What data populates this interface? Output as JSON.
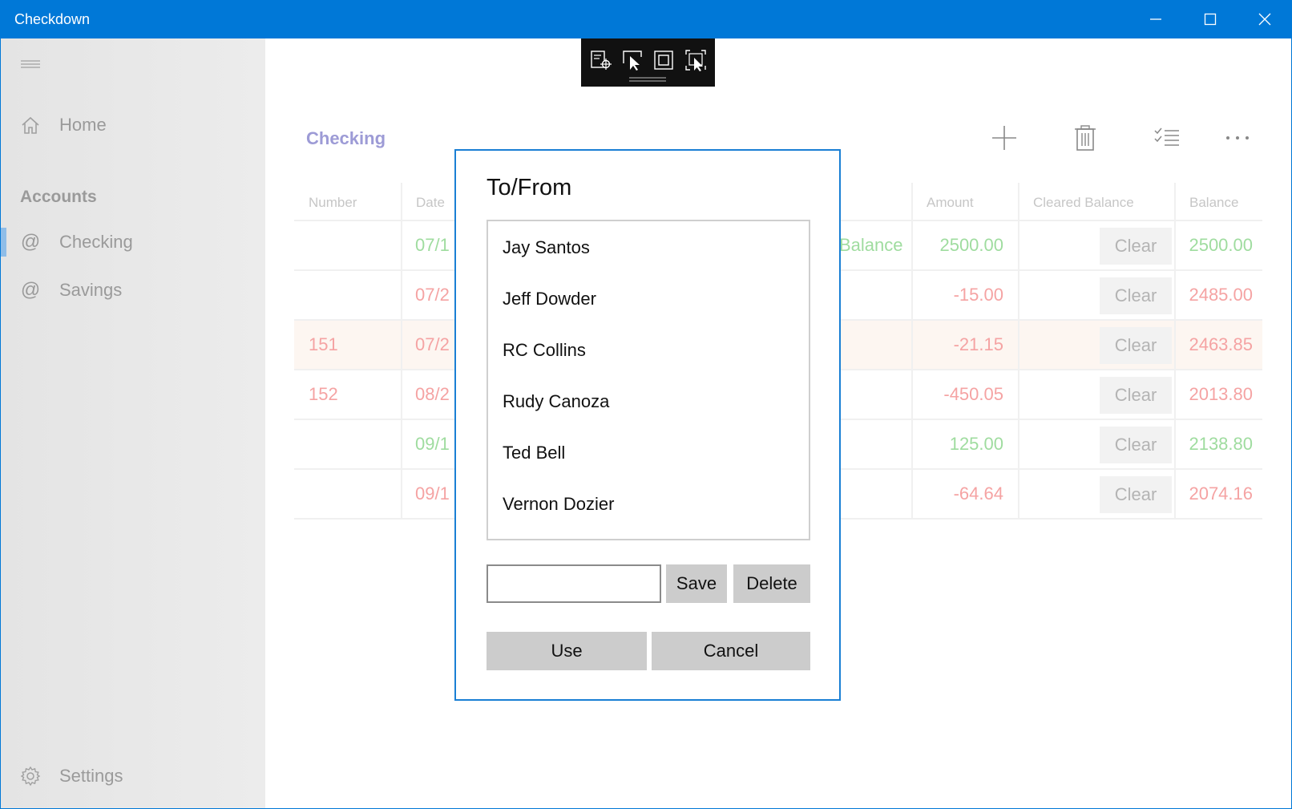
{
  "window": {
    "title": "Checkdown",
    "controls": [
      "minimize-icon",
      "maximize-icon",
      "close-icon"
    ]
  },
  "sidebar": {
    "menu_icon": "hamburger-icon",
    "home": {
      "label": "Home",
      "icon": "home-icon"
    },
    "accounts_heading": "Accounts",
    "accounts": [
      {
        "label": "Checking",
        "icon": "at-icon",
        "selected": true
      },
      {
        "label": "Savings",
        "icon": "at-icon",
        "selected": false
      }
    ],
    "settings": {
      "label": "Settings",
      "icon": "gear-icon"
    },
    "selection_color": "#8fbde8"
  },
  "main": {
    "page_title": "Checking",
    "commands": [
      "add-icon",
      "delete-icon",
      "checklist-icon",
      "more-icon"
    ],
    "table": {
      "headers": {
        "number": "Number",
        "date": "Date",
        "description_partial": "",
        "amount": "Amount",
        "cleared_balance": "Cleared Balance",
        "balance": "Balance"
      },
      "rows": [
        {
          "number": "",
          "date": "07/1",
          "desc": "Balance",
          "amount": "2500.00",
          "cleared": "Clear",
          "balance": "2500.00",
          "tone": "pos",
          "highlighted": false
        },
        {
          "number": "",
          "date": "07/2",
          "desc": "",
          "amount": "-15.00",
          "cleared": "Clear",
          "balance": "2485.00",
          "tone": "neg",
          "highlighted": false
        },
        {
          "number": "151",
          "date": "07/2",
          "desc": "",
          "amount": "-21.15",
          "cleared": "Clear",
          "balance": "2463.85",
          "tone": "neg",
          "highlighted": true
        },
        {
          "number": "152",
          "date": "08/2",
          "desc": "",
          "amount": "-450.05",
          "cleared": "Clear",
          "balance": "2013.80",
          "tone": "neg",
          "highlighted": false
        },
        {
          "number": "",
          "date": "09/1",
          "desc": "",
          "amount": "125.00",
          "cleared": "Clear",
          "balance": "2138.80",
          "tone": "pos",
          "highlighted": false
        },
        {
          "number": "",
          "date": "09/1",
          "desc": "",
          "amount": "-64.64",
          "cleared": "Clear",
          "balance": "2074.16",
          "tone": "neg",
          "highlighted": false
        }
      ]
    }
  },
  "dev_toolbar": {
    "tools": [
      "inspect-tree-icon",
      "select-element-icon",
      "layout-bounds-icon",
      "track-focus-icon"
    ]
  },
  "dialog": {
    "title": "To/From",
    "items": [
      "Jay Santos",
      "Jeff Dowder",
      "RC Collins",
      "Rudy Canoza",
      "Ted Bell",
      "Vernon Dozier"
    ],
    "input_value": "",
    "save_label": "Save",
    "delete_label": "Delete",
    "use_label": "Use",
    "cancel_label": "Cancel"
  },
  "colors": {
    "accent": "#0078d7",
    "positive": "#9fdc9f",
    "negative": "#f5a3a3",
    "title_purple": "#9d9bd6"
  }
}
